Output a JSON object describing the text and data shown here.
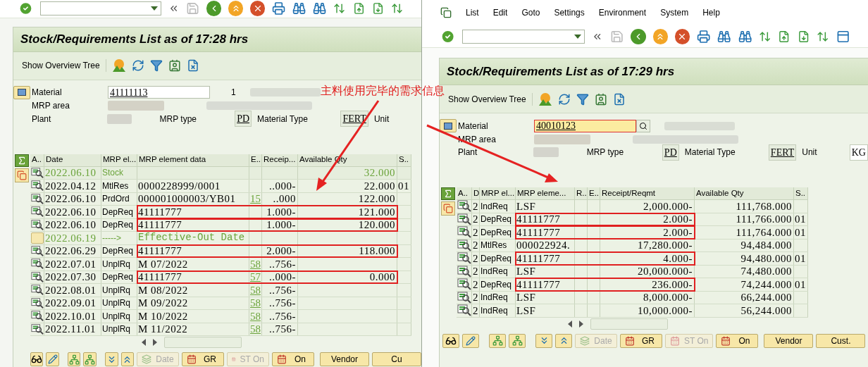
{
  "annotation": {
    "text": "主料使用完毕的需求信息"
  },
  "windows": [
    {
      "title": "Stock/Requirements List as of 17:28 hrs",
      "toolbar_button": "Show Overview Tree",
      "fields": {
        "material_label": "Material",
        "material": "41111113",
        "material_focused": false,
        "count": "1",
        "mrp_area_label": "MRP area",
        "plant_label": "Plant",
        "mrp_type_label": "MRP type",
        "mrp_type": "PD",
        "material_type_label": "Material Type",
        "material_type": "FERT",
        "unit_label": "Unit"
      },
      "table": {
        "columns": [
          "A..",
          "Date",
          "MRP el...",
          "MRP element data",
          "E..",
          "Receip...",
          "Available Qty",
          "S.."
        ],
        "rows": [
          {
            "kind": "stock",
            "date": "2022.06.10",
            "element": "Stock",
            "available": "32.000",
            "highlighted": false
          },
          {
            "kind": "element",
            "date": "2022.04.12",
            "element": "MtlRes",
            "data": "0000228999/0001",
            "receipt": "..000-",
            "available": "22.000",
            "s": "01",
            "highlighted": false
          },
          {
            "kind": "element",
            "date": "2022.06.10",
            "element": "PrdOrd",
            "data": "000001000003/YB01",
            "e": "15",
            "receipt": "..000",
            "available": "122.000",
            "highlighted": false
          },
          {
            "kind": "element",
            "date": "2022.06.10",
            "element": "DepReq",
            "data": "41111777",
            "receipt": "1.000-",
            "available": "121.000",
            "highlighted": true
          },
          {
            "kind": "element",
            "date": "2022.06.10",
            "element": "DepReq",
            "data": "41111777",
            "receipt": "1.000-",
            "available": "120.000",
            "highlighted": true
          },
          {
            "kind": "marker",
            "date": "2022.06.19",
            "element": "----->",
            "data": "Effective-Out Date",
            "highlighted": false
          },
          {
            "kind": "element",
            "date": "2022.06.29",
            "element": "DepReq",
            "data": "41111777",
            "receipt": "2.000-",
            "available": "118.000",
            "highlighted": true
          },
          {
            "kind": "element",
            "date": "2022.07.01",
            "element": "UnplRq",
            "data": "M 07/2022",
            "e": "58",
            "receipt": "..756-",
            "highlighted": false
          },
          {
            "kind": "element",
            "date": "2022.07.30",
            "element": "DepReq",
            "data": "41111777",
            "e": "57",
            "receipt": "..000-",
            "available": "0.000",
            "highlighted": true
          },
          {
            "kind": "element",
            "date": "2022.08.01",
            "element": "UnplRq",
            "data": "M 08/2022",
            "e": "58",
            "receipt": "..756-",
            "highlighted": false
          },
          {
            "kind": "element",
            "date": "2022.09.01",
            "element": "UnplRq",
            "data": "M 09/2022",
            "e": "58",
            "receipt": "..756-",
            "highlighted": false
          },
          {
            "kind": "element",
            "date": "2022.10.01",
            "element": "UnplRq",
            "data": "M 10/2022",
            "e": "58",
            "receipt": "..756-",
            "highlighted": false
          },
          {
            "kind": "element",
            "date": "2022.11.01",
            "element": "UnplRq",
            "data": "M 11/2022",
            "e": "58",
            "receipt": "..756-",
            "highlighted": false
          }
        ]
      },
      "buttons": [
        {
          "label": "Date",
          "kind": "stack",
          "disabled": true
        },
        {
          "label": "GR",
          "kind": "calendar",
          "disabled": false
        },
        {
          "label": "ST On",
          "kind": "calendar",
          "disabled": true
        },
        {
          "label": "On",
          "kind": "calendar",
          "disabled": false
        },
        {
          "label": "Vendor",
          "kind": "plain",
          "disabled": false
        },
        {
          "label": "Cu",
          "kind": "plain",
          "disabled": false
        }
      ]
    },
    {
      "menu": [
        "List",
        "Edit",
        "Goto",
        "Settings",
        "Environment",
        "System",
        "Help"
      ],
      "title": "Stock/Requirements List as of 17:29 hrs",
      "toolbar_button": "Show Overview Tree",
      "fields": {
        "material_label": "Material",
        "material": "40010123",
        "material_focused": true,
        "mrp_area_label": "MRP area",
        "plant_label": "Plant",
        "mrp_type_label": "MRP type",
        "mrp_type": "PD",
        "material_type_label": "Material Type",
        "material_type": "FERT",
        "unit_label": "Unit",
        "unit": "KG"
      },
      "table": {
        "columns": [
          "A..",
          "D",
          "MRP el...",
          "MRP eleme...",
          "R..",
          "E..",
          "Receipt/Reqmt",
          "Available Qty",
          "S.."
        ],
        "rows": [
          {
            "kind": "element",
            "d": "2.",
            "element": "IndReq",
            "data": "LSF",
            "receipt": "2,000.000-",
            "available": "111,768.000",
            "highlighted": false
          },
          {
            "kind": "element",
            "d": "2.",
            "element": "DepReq",
            "data": "41111777",
            "receipt": "2.000-",
            "available": "111,766.000",
            "s": "01",
            "highlighted": true
          },
          {
            "kind": "element",
            "d": "2.",
            "element": "DepReq",
            "data": "41111777",
            "receipt": "2.000-",
            "available": "111,764.000",
            "s": "01",
            "highlighted": true
          },
          {
            "kind": "element",
            "d": "2.",
            "element": "MtlRes",
            "data": "000022924.",
            "receipt": "17,280.000-",
            "available": "94,484.000",
            "highlighted": false
          },
          {
            "kind": "element",
            "d": "2.",
            "element": "DepReq",
            "data": "41111777",
            "receipt": "4.000-",
            "available": "94,480.000",
            "s": "01",
            "highlighted": true
          },
          {
            "kind": "element",
            "d": "2.",
            "element": "IndReq",
            "data": "LSF",
            "receipt": "20,000.000-",
            "available": "74,480.000",
            "highlighted": false
          },
          {
            "kind": "element",
            "d": "2.",
            "element": "DepReq",
            "data": "41111777",
            "receipt": "236.000-",
            "available": "74,244.000",
            "s": "01",
            "highlighted": true
          },
          {
            "kind": "element",
            "d": "2.",
            "element": "IndReq",
            "data": "LSF",
            "receipt": "8,000.000-",
            "available": "66,244.000",
            "highlighted": false
          },
          {
            "kind": "element",
            "d": "2.",
            "element": "IndReq",
            "data": "LSF",
            "receipt": "10,000.000-",
            "available": "56,244.000",
            "highlighted": false
          }
        ]
      },
      "buttons": [
        {
          "label": "Date",
          "kind": "stack",
          "disabled": true
        },
        {
          "label": "GR",
          "kind": "calendar",
          "disabled": false
        },
        {
          "label": "ST On",
          "kind": "calendar",
          "disabled": true
        },
        {
          "label": "On",
          "kind": "calendar",
          "disabled": false
        },
        {
          "label": "Vendor",
          "kind": "plain",
          "disabled": false
        },
        {
          "label": "Cust.",
          "kind": "plain",
          "disabled": false
        }
      ]
    }
  ]
}
